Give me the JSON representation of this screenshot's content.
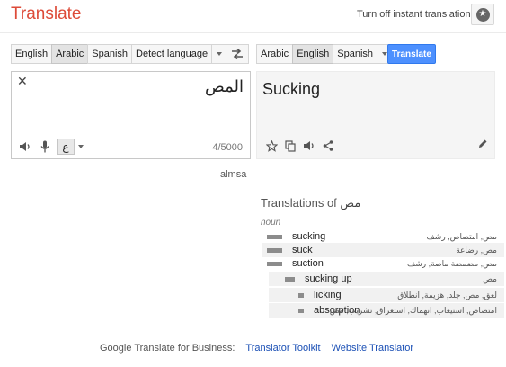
{
  "header": {
    "brand": "Translate",
    "instant_toggle": "Turn off instant translation"
  },
  "source": {
    "languages": [
      "English",
      "Arabic",
      "Spanish",
      "Detect language"
    ],
    "selected": "Arabic",
    "text": "المص",
    "ime_label": "ع",
    "char_count": "4/5000",
    "transliteration": "almsa"
  },
  "target": {
    "languages": [
      "Arabic",
      "English",
      "Spanish"
    ],
    "selected": "English",
    "text": "Sucking",
    "translate_label": "Translate"
  },
  "dictionary": {
    "title_prefix": "Translations of",
    "title_word": "مص",
    "pos": "noun",
    "entries": [
      {
        "term": "sucking",
        "synonyms": "مص, امتصاص, رشف",
        "frequency": 3,
        "indent": 0
      },
      {
        "term": "suck",
        "synonyms": "مص, رضاعة",
        "frequency": 3,
        "indent": 0
      },
      {
        "term": "suction",
        "synonyms": "مص, مضمضة ماصة, رشف",
        "frequency": 3,
        "indent": 0
      },
      {
        "term": "sucking up",
        "synonyms": "مص",
        "frequency": 2,
        "indent": 1
      },
      {
        "term": "licking",
        "synonyms": "لعق, مص, جلد, هزيمة, انطلاق",
        "frequency": 1,
        "indent": 2
      },
      {
        "term": "absorption",
        "synonyms": "امتصاص, استيعاب, انهماك, استغراق, تشريب, مص",
        "frequency": 1,
        "indent": 2
      }
    ]
  },
  "footer": {
    "label": "Google Translate for Business:",
    "links": [
      "Translator Toolkit",
      "Website Translator"
    ]
  },
  "icons": {
    "settings": "gear-icon",
    "swap": "swap-arrows-icon",
    "clear": "close-icon",
    "speaker": "speaker-icon",
    "mic": "microphone-icon",
    "star": "star-icon",
    "copy": "copy-icon",
    "share": "share-icon",
    "edit": "pencil-icon"
  },
  "colors": {
    "brand": "#dd4b39",
    "primary_button": "#4d90fe",
    "link": "#1a4fb5"
  }
}
